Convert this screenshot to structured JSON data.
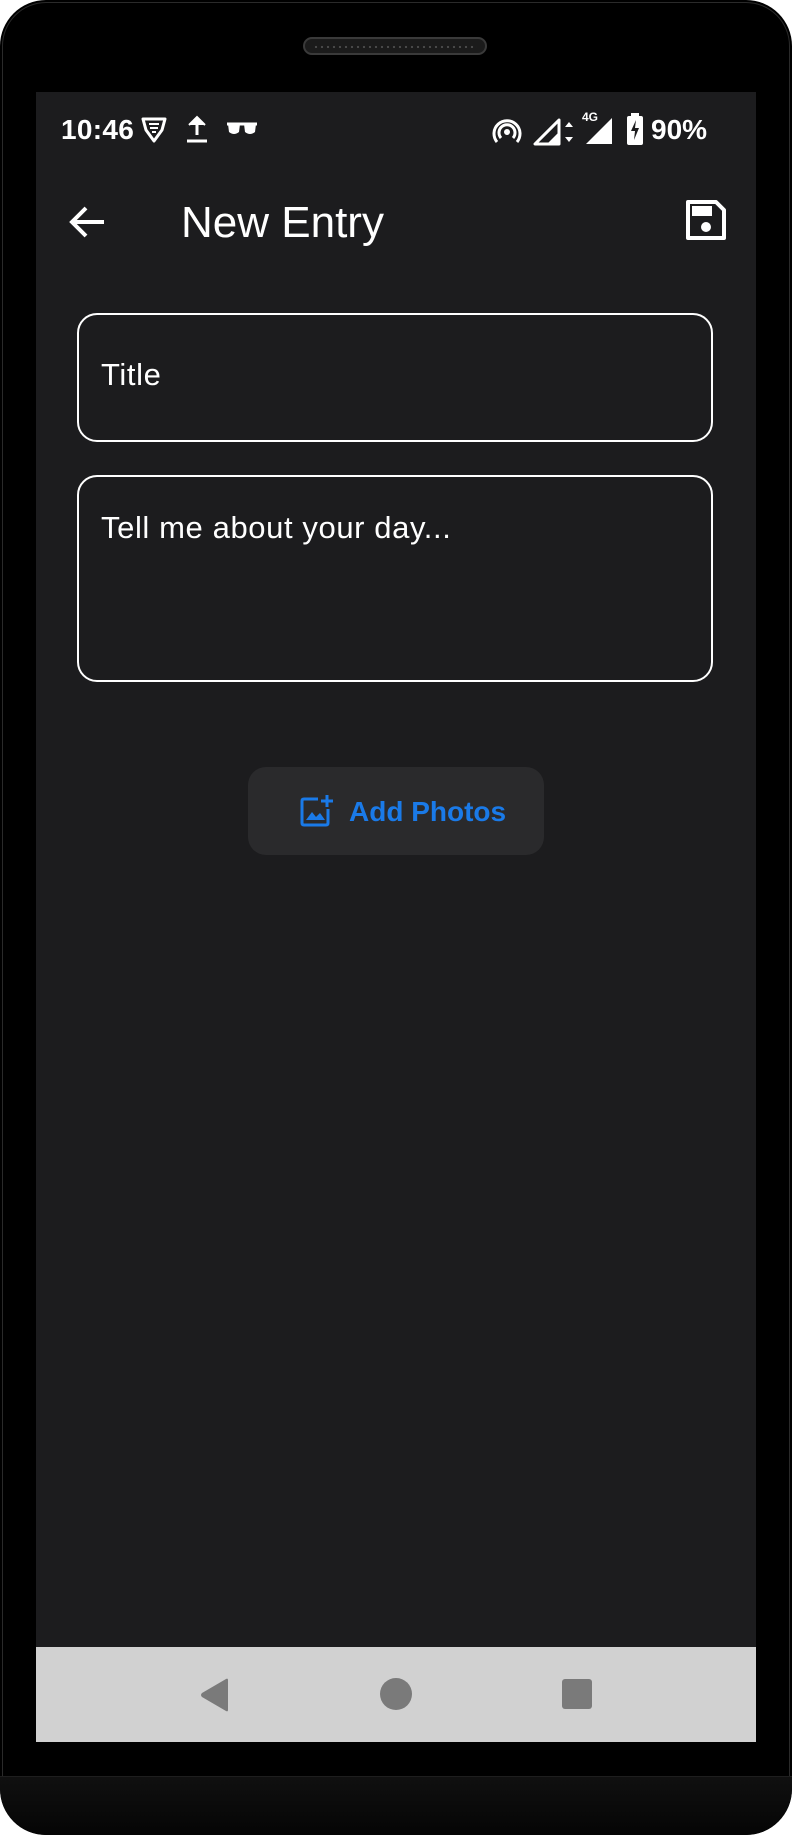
{
  "status_bar": {
    "time": "10:46",
    "battery_percent": "90%",
    "left_icons": [
      "vpn-shield-icon",
      "upload-icon",
      "sunglasses-icon"
    ],
    "right_icons": [
      "hotspot-icon",
      "signal-icon",
      "network-type-icon",
      "battery-charging-icon"
    ],
    "network_type": "4G"
  },
  "app_bar": {
    "title": "New Entry",
    "back_icon": "arrow-left-icon",
    "save_icon": "floppy-disk-icon"
  },
  "form": {
    "title_placeholder": "Title",
    "body_placeholder": "Tell me about your day...",
    "add_photos_label": "Add Photos",
    "add_photos_icon": "add-photo-icon"
  },
  "nav_bar": {
    "back_icon": "nav-back-triangle-icon",
    "home_icon": "nav-home-circle-icon",
    "recents_icon": "nav-recents-square-icon"
  },
  "colors": {
    "screen_background": "#1c1c1e",
    "accent": "#1a7ae8",
    "text": "#ffffff",
    "nav_bar_background": "#d1d1d1",
    "button_background": "#2a2a2c"
  }
}
